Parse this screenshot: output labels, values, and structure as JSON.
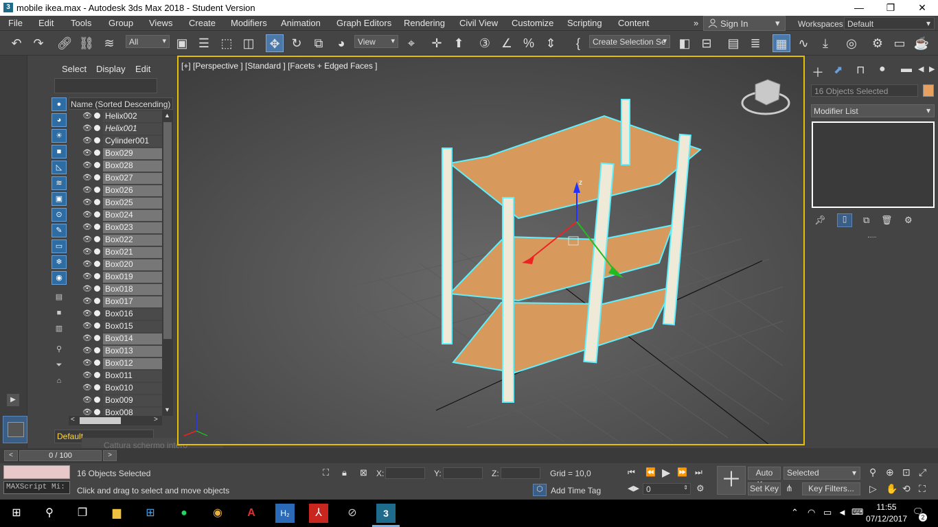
{
  "titlebar": {
    "title": "mobile ikea.max - Autodesk 3ds Max 2018 - Student Version",
    "app_icon": "3",
    "min": "—",
    "restore": "❐",
    "close": "✕"
  },
  "menu": {
    "items": [
      "File",
      "Edit",
      "Tools",
      "Group",
      "Views",
      "Create",
      "Modifiers",
      "Animation",
      "Graph Editors",
      "Rendering",
      "Civil View",
      "Customize",
      "Scripting",
      "Content"
    ],
    "more": "»",
    "sign_in": "Sign In",
    "workspaces_label": "Workspaces:",
    "workspace": "Default"
  },
  "toolbar": {
    "selection_filter": "All",
    "ref_coord": "View",
    "selection_set": "Create Selection Se"
  },
  "explorer": {
    "tabs": [
      "Select",
      "Display",
      "Edit"
    ],
    "column_header": "Name (Sorted Descending)",
    "rows": [
      {
        "name": "Helix002",
        "style": "dark"
      },
      {
        "name": "Helix001",
        "style": "dark"
      },
      {
        "name": "Cylinder001",
        "style": "dark"
      },
      {
        "name": "Box029",
        "style": "sel"
      },
      {
        "name": "Box028",
        "style": "sel"
      },
      {
        "name": "Box027",
        "style": "sel"
      },
      {
        "name": "Box026",
        "style": "sel"
      },
      {
        "name": "Box025",
        "style": "sel"
      },
      {
        "name": "Box024",
        "style": "sel"
      },
      {
        "name": "Box023",
        "style": "sel"
      },
      {
        "name": "Box022",
        "style": "sel"
      },
      {
        "name": "Box021",
        "style": "sel"
      },
      {
        "name": "Box020",
        "style": "sel"
      },
      {
        "name": "Box019",
        "style": "sel"
      },
      {
        "name": "Box018",
        "style": "sel"
      },
      {
        "name": "Box017",
        "style": "sel"
      },
      {
        "name": "Box016",
        "style": "dark"
      },
      {
        "name": "Box015",
        "style": "dark"
      },
      {
        "name": "Box014",
        "style": "sel"
      },
      {
        "name": "Box013",
        "style": "sel"
      },
      {
        "name": "Box012",
        "style": "sel"
      },
      {
        "name": "Box011",
        "style": "dark"
      },
      {
        "name": "Box010",
        "style": "dark"
      },
      {
        "name": "Box009",
        "style": "dark"
      },
      {
        "name": "Box008",
        "style": "dark"
      }
    ],
    "layer": "Default",
    "tooltip": "Cattura schermo intero"
  },
  "viewport": {
    "label": "[+] [Perspective ] [Standard ] [Facets + Edged Faces ]",
    "border_color": "#e8c000",
    "shelf_color": "#d89a5c",
    "selection_outline": "#5ff0ff",
    "gizmo_z": "z"
  },
  "command_panel": {
    "selection": "16 Objects Selected",
    "selection_color": "#e8a060",
    "modifier_list": "Modifier List"
  },
  "timeslider": {
    "frame": "0 / 100",
    "prev": "<",
    "next": ">"
  },
  "status": {
    "maxscript": "MAXScript Mi:",
    "selected": "16 Objects Selected",
    "prompt": "Click and drag to select and move objects",
    "x_label": "X:",
    "y_label": "Y:",
    "z_label": "Z:",
    "grid": "Grid = 10,0",
    "add_time_tag": "Add Time Tag",
    "auto_key": "Auto Key",
    "set_key": "Set Key",
    "key_mode": "Selected",
    "key_filters": "Key Filters...",
    "frame_value": "0"
  },
  "taskbar": {
    "time": "11:55",
    "date": "07/12/2017",
    "notifications": "2"
  }
}
